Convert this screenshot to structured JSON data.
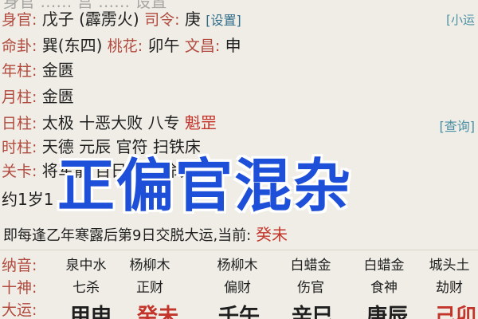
{
  "top_row": {
    "text": "身官 …… 宫 …… 设置"
  },
  "shen_guan": {
    "label": "身官:",
    "value": "戊子 (霹雳火)",
    "siling_label": "司令:",
    "siling_value": "庚",
    "set_btn": "[设置]",
    "right_tag": "[小运"
  },
  "ming_gua": {
    "label": "命卦:",
    "value": "巽(东四)",
    "taohua_label": "桃花:",
    "taohua_value": "卯午",
    "wenchang_label": "文昌:",
    "wenchang_value": "申"
  },
  "nian_zhu": {
    "label": "年柱:",
    "value": "金匮"
  },
  "yue_zhu": {
    "label": "月柱:",
    "value": "金匮"
  },
  "ri_zhu": {
    "label": "日柱:",
    "v1": "太极",
    "v2": "十恶大败",
    "v3": "八专",
    "v4": "魁罡",
    "query_btn": "[查询]"
  },
  "shi_zhu": {
    "label": "时柱:",
    "v1": "天德",
    "v2": "元辰",
    "v3": "官符",
    "v4": "扫铁床"
  },
  "guan_ka": {
    "label": "关卡:",
    "value": "将军箭 百日关 短命关"
  },
  "yue_line": {
    "text": "约1岁1"
  },
  "jiao_line": {
    "text": "即每逢乙年寒露后第9日交脱大运,当前:",
    "current": "癸未"
  },
  "banner": {
    "text": "正偏官混杂"
  },
  "nayin": {
    "label": "纳音:",
    "cells": [
      "泉中水",
      "杨柳木",
      "杨柳木",
      "白蜡金",
      "白蜡金",
      "城头土"
    ]
  },
  "shishen": {
    "label": "十神:",
    "cells": [
      "七杀",
      "正财",
      "偏财",
      "伤官",
      "食神",
      "劫财"
    ]
  },
  "dayun": {
    "label": "大运:",
    "cells": [
      "甲申",
      "癸未",
      "壬午",
      "辛巳",
      "庚辰",
      "己卯"
    ]
  },
  "colors": {
    "label": "#b24b3f",
    "accent_red": "#c3352b",
    "green": "#2e7d2e",
    "banner": "#1e4fd8",
    "link": "#4a90a4"
  }
}
